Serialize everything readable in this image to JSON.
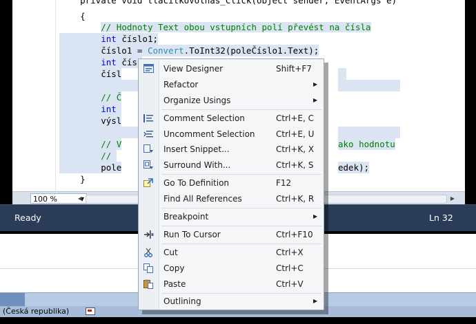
{
  "code_lines": [
    "    private void tlacitkoVolnas_Click(object sender, EventArgs e)",
    "    {",
    "        // Hodnoty Text obou vstupních polí převést na čísla",
    "        int číslo1;",
    "        číslo1 = Convert.ToInt32(poleČíslo1.Text);",
    "        int číslo2;",
    "        čísl",
    "",
    "        // Č",
    "        int ",
    "        výsl",
    "",
    "        // V",
    "        // ",
    "        pole",
    "    }"
  ],
  "code_fragments": {
    "comment_line3_tail": "ako hodnotu",
    "line_tail": "edek);"
  },
  "zoom": "100 %",
  "status": {
    "ready": "Ready",
    "line": "Ln 32"
  },
  "language_bar": "(Česká republika)",
  "menu": [
    {
      "label": "View Designer",
      "shortcut": "Shift+F7",
      "icon": "view-designer-icon"
    },
    {
      "label": "Refactor",
      "submenu": true
    },
    {
      "label": "Organize Usings",
      "submenu": true
    },
    {
      "label": "Comment Selection",
      "shortcut": "Ctrl+E, C",
      "icon": "comment-icon"
    },
    {
      "label": "Uncomment Selection",
      "shortcut": "Ctrl+E, U",
      "icon": "uncomment-icon"
    },
    {
      "label": "Insert Snippet...",
      "shortcut": "Ctrl+K, X",
      "icon": "snippet-icon"
    },
    {
      "label": "Surround With...",
      "shortcut": "Ctrl+K, S",
      "icon": "surround-icon"
    },
    {
      "label": "Go To Definition",
      "shortcut": "F12",
      "icon": "go-to-definition-icon"
    },
    {
      "label": "Find All References",
      "shortcut": "Ctrl+K, R"
    },
    {
      "label": "Breakpoint",
      "submenu": true
    },
    {
      "label": "Run To Cursor",
      "shortcut": "Ctrl+F10",
      "icon": "run-to-cursor-icon"
    },
    {
      "label": "Cut",
      "shortcut": "Ctrl+X",
      "icon": "scissors-icon"
    },
    {
      "label": "Copy",
      "shortcut": "Ctrl+C",
      "icon": "copy-icon"
    },
    {
      "label": "Paste",
      "shortcut": "Ctrl+V",
      "icon": "paste-icon"
    },
    {
      "label": "Outlining",
      "submenu": true
    }
  ],
  "colors": {
    "keyword": "#0000ff",
    "comment": "#008000",
    "type": "#2b91af",
    "selection": "#dae4f2",
    "statusbar": "#2b3c59"
  }
}
